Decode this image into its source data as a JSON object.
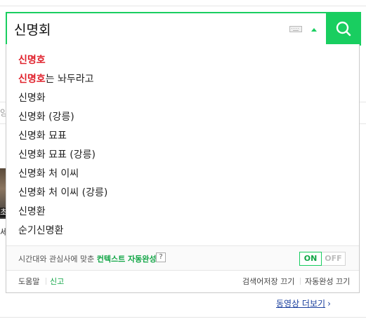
{
  "search": {
    "query": "신명회"
  },
  "suggestions": [
    {
      "highlight": "신명호",
      "rest": ""
    },
    {
      "highlight": "신명호",
      "rest": "는 놔두라고"
    },
    {
      "highlight": "",
      "rest": "신명화"
    },
    {
      "highlight": "",
      "rest": "신명화 (강릉)"
    },
    {
      "highlight": "",
      "rest": "신명화 묘표"
    },
    {
      "highlight": "",
      "rest": "신명화 묘표 (강릉)"
    },
    {
      "highlight": "",
      "rest": "신명화 처 이씨"
    },
    {
      "highlight": "",
      "rest": "신명화 처 이씨 (강릉)"
    },
    {
      "highlight": "",
      "rest": "신명환"
    },
    {
      "highlight": "",
      "rest": "순기신명환"
    }
  ],
  "context": {
    "text_prefix": "시간대와 관심사에 맞춘 ",
    "text_highlight": "컨텍스트 자동완성",
    "help": "?",
    "on_label": "ON",
    "off_label": "OFF"
  },
  "footer": {
    "help": "도움말",
    "report": "신고",
    "search_history_off": "검색어저장 끄기",
    "autocomplete_off": "자동완성 끄기"
  },
  "background": {
    "more_videos": "동영상 더보기",
    "more_chevron": "›",
    "thumb_caption": "초",
    "left_char": "세",
    "left_char2": "양"
  },
  "colors": {
    "accent": "#19ce60",
    "highlight": "#e0202b",
    "link_green": "#10a545",
    "link_blue": "#1a3f9e"
  },
  "icons": {
    "search_button": "magnifier-icon",
    "keyboard": "keyboard-icon",
    "collapse": "arrow-up-icon"
  }
}
